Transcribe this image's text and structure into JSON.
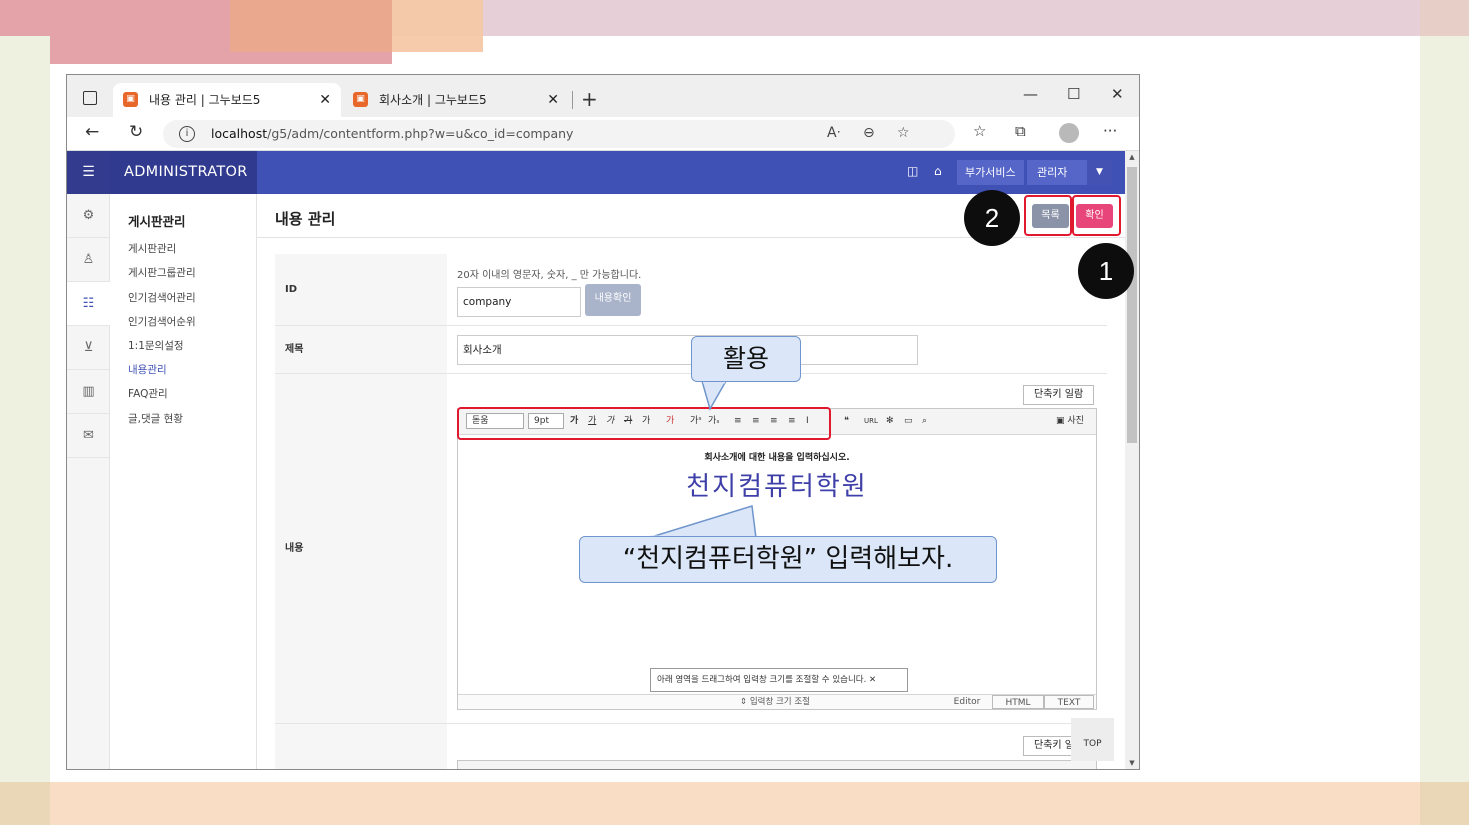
{
  "browser": {
    "tabs": [
      {
        "title": "내용 관리 | 그누보드5",
        "favicon": "gnuboard-icon"
      },
      {
        "title": "회사소개 | 그누보드5",
        "favicon": "gnuboard-icon"
      }
    ],
    "url_host": "localhost",
    "url_path": "/g5/adm/contentform.php?w=u&co_id=company"
  },
  "admin": {
    "brand": "ADMINISTRATOR",
    "top_buttons": {
      "service": "부가서비스",
      "admin": "관리자"
    }
  },
  "sidebar": {
    "heading": "게시판관리",
    "items": [
      "게시판관리",
      "게시판그룹관리",
      "인기검색어관리",
      "인기검색어순위",
      "1:1문의설정",
      "내용관리",
      "FAQ관리",
      "글,댓글 현황"
    ],
    "active": "내용관리"
  },
  "main": {
    "title": "내용 관리",
    "list_button": "목록",
    "ok_button": "확인"
  },
  "form": {
    "id_label": "ID",
    "id_help": "20자 이내의 영문자, 숫자, _ 만 가능합니다.",
    "id_value": "company",
    "id_check_button": "내용확인",
    "subject_label": "제목",
    "subject_value": "회사소개",
    "content_label": "내용",
    "shortcut_button": "단축키 일람"
  },
  "editor": {
    "font_select": "돋움",
    "size_select": "9pt",
    "photo_button": "사진",
    "content_line1": "회사소개에 대한 내용을 입력하십시오.",
    "content_line2": "천지컴퓨터학원",
    "drag_tip": "아래 영역을 드래그하여 입력창 크기를 조절할 수 있습니다.",
    "resize_label": "입력창 크기 조절",
    "modes": [
      "Editor",
      "HTML",
      "TEXT"
    ]
  },
  "overlay": {
    "callout_use": "활용",
    "callout_input": "“천지컴퓨터학원” 입력해보자.",
    "marker_1": "1",
    "marker_2": "2",
    "top_button": "TOP"
  },
  "colors": {
    "admin_bar": "#3f51b5",
    "ok_button": "#e8467a",
    "highlight_box": "#e1192f"
  }
}
